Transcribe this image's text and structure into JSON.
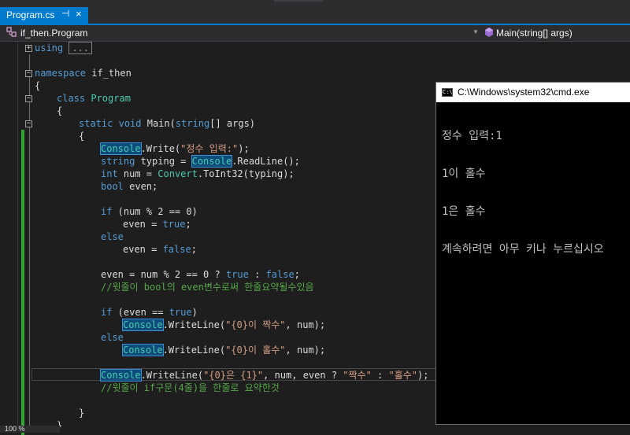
{
  "tab": {
    "label": "Program.cs",
    "pin_icon": "⊣",
    "close_icon": "×"
  },
  "nav": {
    "class_path": "if_then.Program",
    "member": "Main(string[] args)"
  },
  "editor": {
    "using_kw": "using",
    "collapsed_text": "...",
    "ns_kw": "namespace",
    "ns_name": " if_then",
    "brace_open": "{",
    "brace_close": "}",
    "class_kw": "class",
    "class_name": "Program",
    "static_kw": "static",
    "void_kw": "void",
    "main_sig_1": " Main(",
    "string_kw": "string",
    "main_sig_2": "[] args)",
    "console": "Console",
    "write_1": ".Write(",
    "write_str": "\"정수 입력:\"",
    "write_end": ");",
    "typing_decl": " typing = ",
    "readline": ".ReadLine();",
    "int_kw": "int",
    "num_decl": " num = ",
    "convert": "Convert",
    "toint": ".ToInt32(typing);",
    "bool_kw": "bool",
    "even_decl": " even;",
    "if_kw": "if",
    "if_cond_1": " (num % 2 == 0)",
    "even_assign": "even = ",
    "true_kw": "true",
    "false_kw": "false",
    "semi": ";",
    "else_kw": "else",
    "ternary_1": "even = num % 2 == 0 ? ",
    "ternary_colon": " : ",
    "comment_1": "//윗줄이 bool의 even변수로써 한줄요약될수있음",
    "if_cond_2a": " (even == ",
    "if_cond_2b": ")",
    "writeline": ".WriteLine(",
    "str_even": "\"{0}이 짝수\"",
    "str_odd": "\"{0}이 홀수\"",
    "args_num": ", num);",
    "str_fmt": "\"{0}은 {1}\"",
    "args_ternary": ", num, even ? ",
    "str_jjak": "\"짝수\"",
    "str_hol": "\"홀수\"",
    "tail": ");",
    "comment_2": "//윗줄이 if구문(4줄)을 한줄로 요약한것"
  },
  "zoom": "100 %",
  "console_window": {
    "title": "C:\\Windows\\system32\\cmd.exe",
    "icon_text": "C:\\",
    "lines": [
      "정수 입력:1",
      "1이 홀수",
      "1은 홀수",
      "계속하려면 아무 키나 누르십시오"
    ]
  }
}
